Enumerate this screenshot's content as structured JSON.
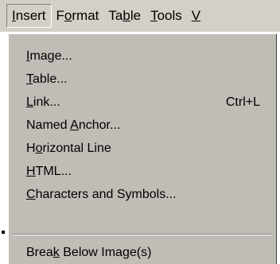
{
  "menubar": {
    "items": [
      {
        "pre": "",
        "mn": "I",
        "post": "nsert"
      },
      {
        "pre": "F",
        "mn": "o",
        "post": "rmat"
      },
      {
        "pre": "Ta",
        "mn": "b",
        "post": "le"
      },
      {
        "pre": "",
        "mn": "T",
        "post": "ools"
      },
      {
        "pre": "",
        "mn": "V",
        "post": ""
      }
    ]
  },
  "menu": {
    "items": [
      {
        "pre": "",
        "mn": "I",
        "post": "mage...",
        "shortcut": ""
      },
      {
        "pre": "",
        "mn": "T",
        "post": "able...",
        "shortcut": ""
      },
      {
        "pre": "",
        "mn": "L",
        "post": "ink...",
        "shortcut": "Ctrl+L"
      },
      {
        "pre": "Named ",
        "mn": "A",
        "post": "nchor...",
        "shortcut": ""
      },
      {
        "pre": "H",
        "mn": "o",
        "post": "rizontal Line",
        "shortcut": ""
      },
      {
        "pre": "",
        "mn": "H",
        "post": "TML...",
        "shortcut": ""
      },
      {
        "pre": "",
        "mn": "C",
        "post": "haracters and Symbols...",
        "shortcut": ""
      },
      {
        "pre": "Brea",
        "mn": "k",
        "post": " Below Image(s)",
        "shortcut": ""
      }
    ]
  }
}
